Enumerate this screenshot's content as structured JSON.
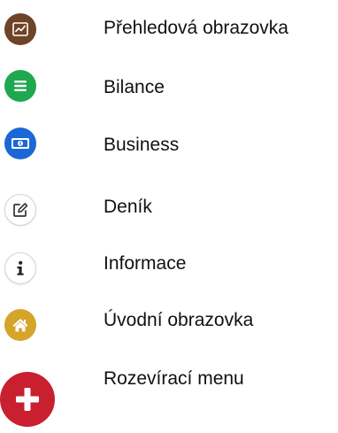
{
  "menu": {
    "items": [
      {
        "label": "Přehledová obrazovka",
        "icon": "chart-icon",
        "color": "#6f4326"
      },
      {
        "label": "Bilance",
        "icon": "list-icon",
        "color": "#1fa84f"
      },
      {
        "label": "Business",
        "icon": "banknote-icon",
        "color": "#1b67d6"
      },
      {
        "label": "Deník",
        "icon": "edit-icon",
        "color": "#ffffff"
      },
      {
        "label": "Informace",
        "icon": "info-icon",
        "color": "#ffffff"
      },
      {
        "label": "Úvodní obrazovka",
        "icon": "home-icon",
        "color": "#d5a52a"
      },
      {
        "label": "Rozevírací menu",
        "icon": "plus-icon",
        "color": "#c8202f"
      }
    ]
  }
}
